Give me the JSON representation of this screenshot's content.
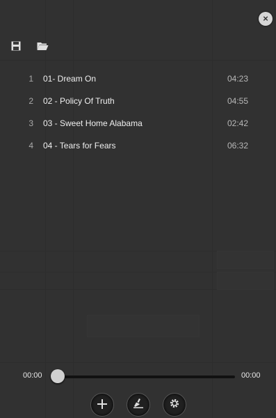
{
  "dialog": {
    "close_glyph": "×"
  },
  "toolbar": {
    "save_icon": "save-icon",
    "open_icon": "folder-open-icon"
  },
  "playlist": {
    "tracks": [
      {
        "num": "1",
        "title": "01- Dream On",
        "duration": "04:23"
      },
      {
        "num": "2",
        "title": "02 - Policy Of Truth",
        "duration": "04:55"
      },
      {
        "num": "3",
        "title": "03 - Sweet Home Alabama",
        "duration": "02:42"
      },
      {
        "num": "4",
        "title": "04 - Tears for Fears",
        "duration": "06:32"
      }
    ]
  },
  "seek": {
    "current_time": "00:00",
    "total_time": "00:00",
    "progress": 0
  },
  "bottom": {
    "add_icon": "plus-icon",
    "clear_icon": "broom-icon",
    "settings_icon": "gear-icon"
  }
}
